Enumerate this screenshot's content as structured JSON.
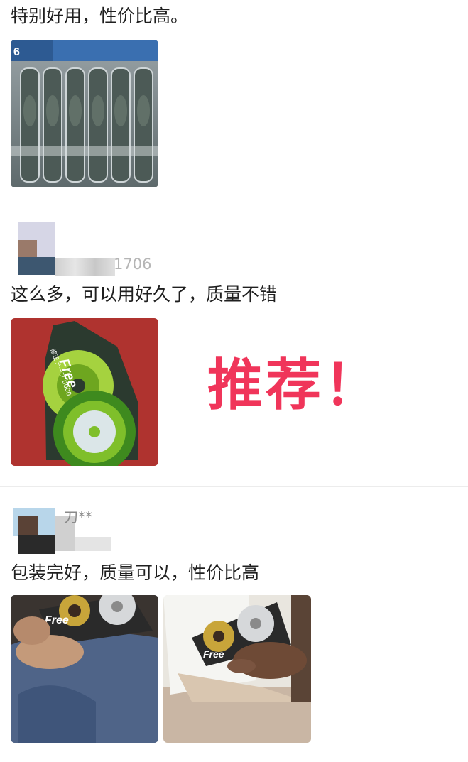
{
  "reviews": [
    {
      "text": "特别好用，性价比高。",
      "photos": [
        "tape-pack-photo"
      ]
    },
    {
      "meta": "1706",
      "text": "这么多，可以用好久了，质量不错",
      "photos": [
        "free-tape-green-photo"
      ],
      "annotation": "推荐！"
    },
    {
      "meta": "刀**",
      "text": "包装完好，质量可以，性价比高",
      "photos": [
        "hand-holding-tape-photo",
        "tape-on-paper-photo"
      ]
    }
  ],
  "photo_labels": {
    "pack_badge": "6",
    "brand": "Free",
    "green_sub": "修正テープ 0000"
  },
  "colors": {
    "annotation": "#f0355a",
    "divider": "#ececec",
    "meta": "#b5b5b5"
  }
}
